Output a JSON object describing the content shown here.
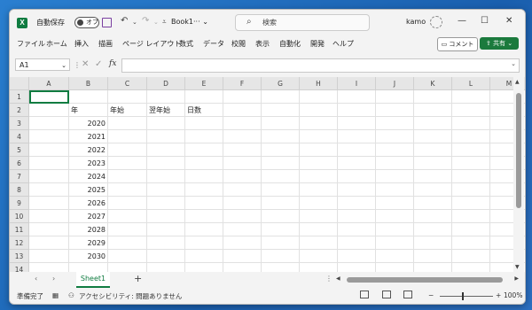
{
  "titlebar": {
    "autosave_label": "自動保存",
    "autosave_state": "オフ",
    "doc_title": "Book1···",
    "doc_title_chevron": "⌄",
    "search_placeholder": "検索",
    "user_name": "kamo"
  },
  "menu": [
    "ファイル",
    "ホーム",
    "挿入",
    "描画",
    "ページ レイアウト",
    "数式",
    "データ",
    "校閲",
    "表示",
    "自動化",
    "開発",
    "ヘルプ"
  ],
  "buttons": {
    "comment": "コメント",
    "share": "共有"
  },
  "formula_bar": {
    "name_box": "A1",
    "fx": "fx",
    "value": ""
  },
  "grid": {
    "columns": [
      "A",
      "B",
      "C",
      "D",
      "E",
      "F",
      "G",
      "H",
      "I",
      "J",
      "K",
      "L",
      "M"
    ],
    "rows": [
      "1",
      "2",
      "3",
      "4",
      "5",
      "6",
      "7",
      "8",
      "9",
      "10",
      "11",
      "12",
      "13",
      "14"
    ],
    "headers_row2": {
      "B": "年",
      "C": "年始",
      "D": "翌年始",
      "E": "日数"
    },
    "years": [
      "2020",
      "2021",
      "2022",
      "2023",
      "2024",
      "2025",
      "2026",
      "2027",
      "2028",
      "2029",
      "2030"
    ],
    "selected_cell": "A1"
  },
  "sheets": {
    "tabs": [
      "Sheet1"
    ],
    "active": "Sheet1"
  },
  "status": {
    "ready": "準備完了",
    "accessibility": "アクセシビリティ: 問題ありません",
    "zoom": "100%"
  },
  "icons": {
    "search": "search-icon",
    "undo": "undo-icon",
    "redo": "redo-icon",
    "save": "save-icon",
    "minimize": "minimize-icon",
    "maximize": "maximize-icon",
    "close": "close-icon"
  },
  "colors": {
    "accent": "#107c41",
    "share_bg": "#1b7a3d"
  }
}
